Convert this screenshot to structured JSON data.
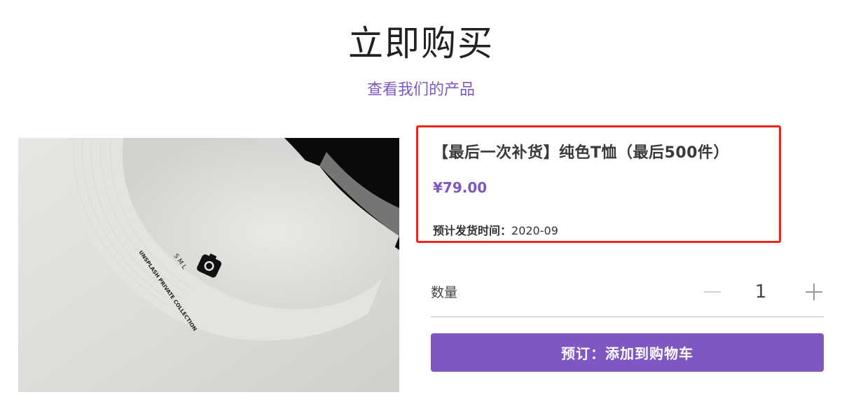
{
  "header": {
    "title": "立即购买",
    "products_link": "查看我们的产品"
  },
  "product": {
    "name": "【最后一次补货】纯色T恤（最后500件）",
    "price": "¥79.00",
    "ship_label": "预计发货时间：",
    "ship_date": "2020-09",
    "image_label_brand": "UNSPLASH PRIVATE COLLECTION",
    "image_label_sizes": "S  M  L",
    "image_icon": "camera-logo-icon"
  },
  "quantity": {
    "label": "数量",
    "minus_icon": "minus-icon",
    "plus_icon": "plus-icon",
    "value": "1"
  },
  "actions": {
    "add_to_cart": "预订：添加到购物车"
  },
  "colors": {
    "accent": "#7e57c2",
    "highlight_border": "#e8291e"
  }
}
